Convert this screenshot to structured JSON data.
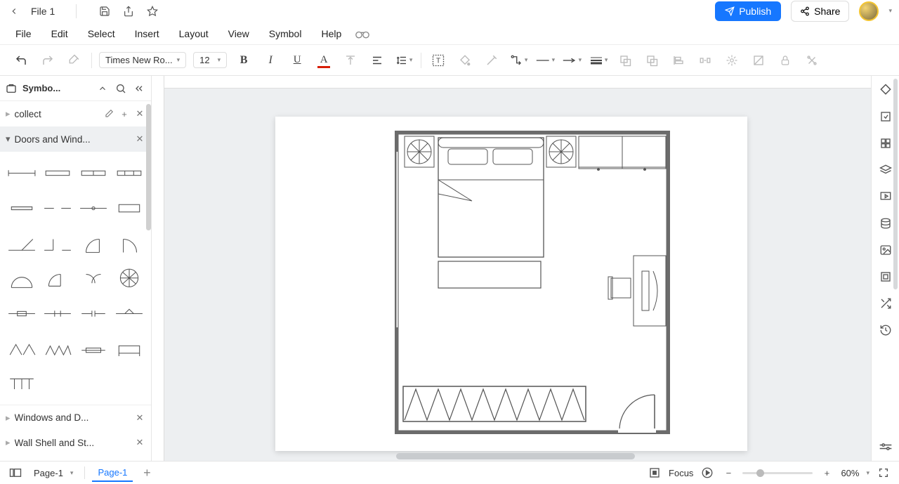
{
  "file": {
    "name": "File 1"
  },
  "menus": [
    "File",
    "Edit",
    "Select",
    "Insert",
    "Layout",
    "View",
    "Symbol",
    "Help"
  ],
  "toolbar": {
    "font": "Times New Ro...",
    "font_size": "12"
  },
  "actions": {
    "publish": "Publish",
    "share": "Share"
  },
  "sidebar": {
    "title": "Symbo...",
    "libs": [
      {
        "label": "collect",
        "expanded": false,
        "closeable": true,
        "editable": true
      },
      {
        "label": "Doors and Wind...",
        "expanded": true,
        "closeable": true
      },
      {
        "label": "Windows and D...",
        "expanded": false,
        "closeable": true
      },
      {
        "label": "Wall Shell and St...",
        "expanded": false,
        "closeable": true
      }
    ]
  },
  "status": {
    "page_select": "Page-1",
    "page_tab": "Page-1",
    "focus": "Focus",
    "zoom": "60%"
  }
}
